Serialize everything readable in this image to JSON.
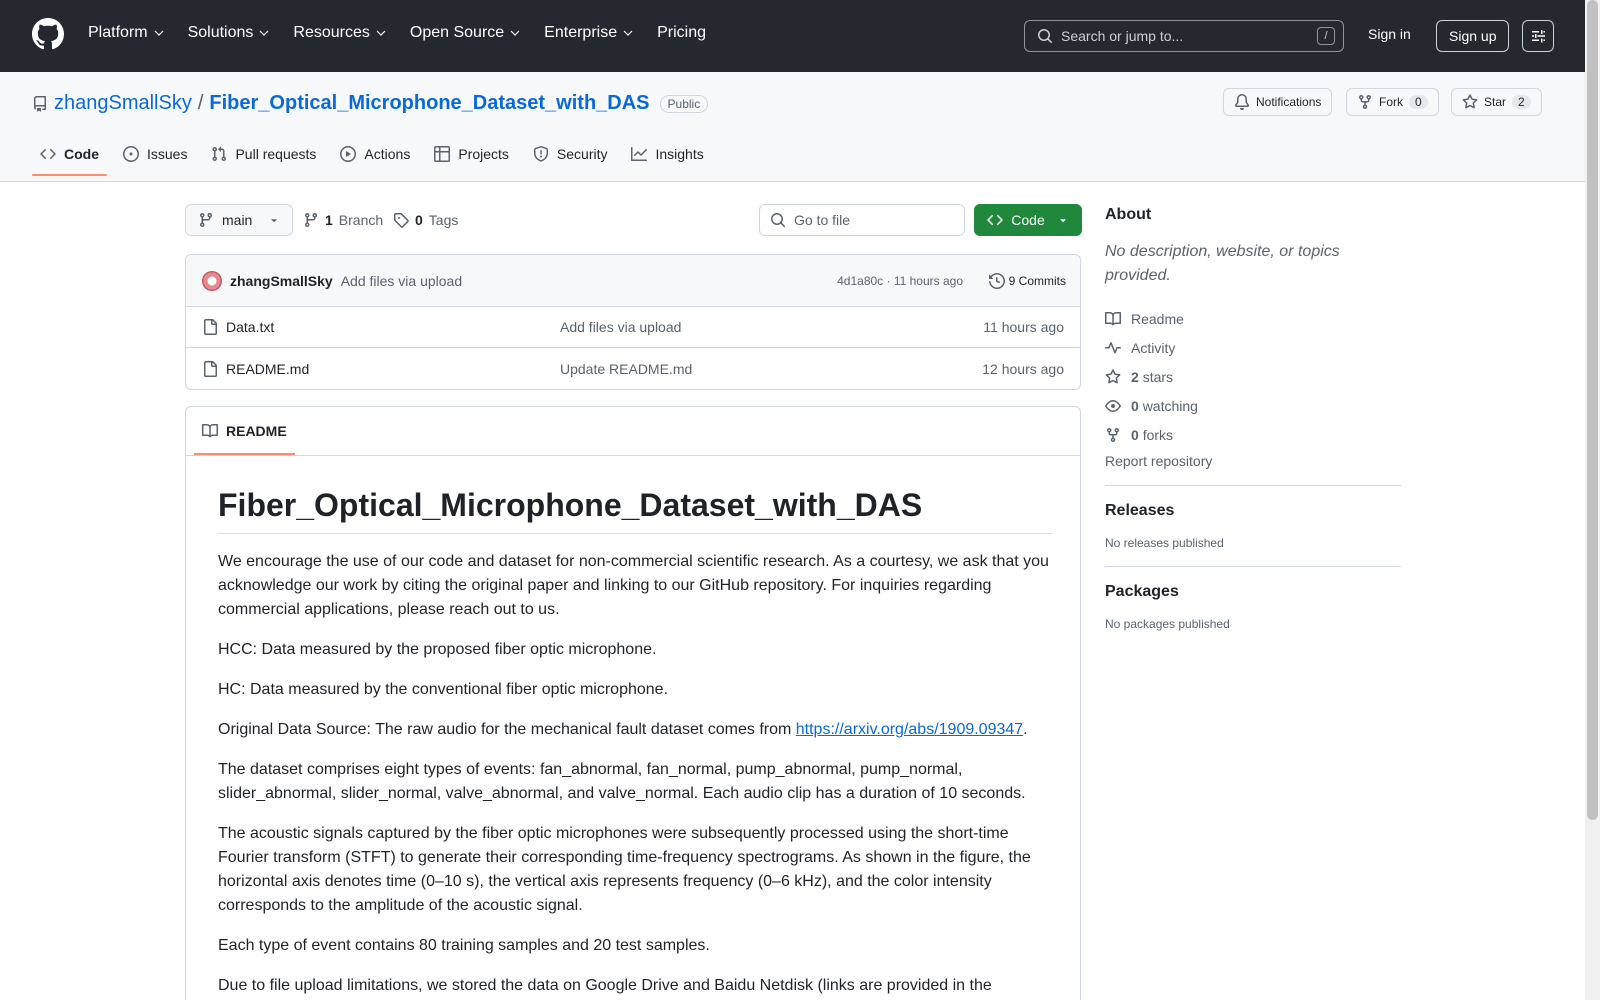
{
  "header": {
    "nav": [
      {
        "label": "Platform",
        "chevron": true
      },
      {
        "label": "Solutions",
        "chevron": true
      },
      {
        "label": "Resources",
        "chevron": true
      },
      {
        "label": "Open Source",
        "chevron": true
      },
      {
        "label": "Enterprise",
        "chevron": true
      },
      {
        "label": "Pricing",
        "chevron": false
      }
    ],
    "search_placeholder": "Search or jump to...",
    "search_shortcut": "/",
    "sign_in": "Sign in",
    "sign_up": "Sign up"
  },
  "repo": {
    "owner": "zhangSmallSky",
    "separator": "/",
    "name": "Fiber_Optical_Microphone_Dataset_with_DAS",
    "visibility": "Public",
    "notifications_label": "Notifications",
    "fork_label": "Fork",
    "fork_count": "0",
    "star_label": "Star",
    "star_count": "2"
  },
  "tabs": [
    "Code",
    "Issues",
    "Pull requests",
    "Actions",
    "Projects",
    "Security",
    "Insights"
  ],
  "toolbar": {
    "branch": "main",
    "branch_count": "1",
    "branch_label": "Branch",
    "tag_count": "0",
    "tag_label": "Tags",
    "go_to_file": "Go to file",
    "code_button": "Code"
  },
  "commit": {
    "author": "zhangSmallSky",
    "message": "Add files via upload",
    "sha_time": "4d1a80c · 11 hours ago",
    "commits": "9 Commits"
  },
  "files": [
    {
      "name": "Data.txt",
      "message": "Add files via upload",
      "time": "11 hours ago"
    },
    {
      "name": "README.md",
      "message": "Update README.md",
      "time": "12 hours ago"
    }
  ],
  "readme": {
    "tab": "README",
    "title": "Fiber_Optical_Microphone_Dataset_with_DAS",
    "p1": "We encourage the use of our code and dataset for non-commercial scientific research. As a courtesy, we ask that you acknowledge our work by citing the original paper and linking to our GitHub repository. For inquiries regarding commercial applications, please reach out to us.",
    "p2": "HCC: Data measured by the proposed fiber optic microphone.",
    "p3": "HC: Data measured by the conventional fiber optic microphone.",
    "p4_prefix": "Original Data Source: The raw audio for the mechanical fault dataset comes from ",
    "p4_link": "https://arxiv.org/abs/1909.09347",
    "p4_suffix": ".",
    "p5": "The dataset comprises eight types of events: fan_abnormal, fan_normal, pump_abnormal, pump_normal, slider_abnormal, slider_normal, valve_abnormal, and valve_normal. Each audio clip has a duration of 10 seconds.",
    "p6": "The acoustic signals captured by the fiber optic microphones were subsequently processed using the short-time Fourier transform (STFT) to generate their corresponding time-frequency spectrograms. As shown in the figure, the horizontal axis denotes time (0–10 s), the vertical axis represents frequency (0–6 kHz), and the color intensity corresponds to the amplitude of the acoustic signal.",
    "p7": "Each type of event contains 80 training samples and 20 test samples.",
    "p8": "Due to file upload limitations, we stored the data on Google Drive and Baidu Netdisk (links are provided in the"
  },
  "about": {
    "title": "About",
    "description": "No description, website, or topics provided.",
    "readme": "Readme",
    "activity": "Activity",
    "stars_count": "2",
    "stars_label": "stars",
    "watching_count": "0",
    "watching_label": "watching",
    "forks_count": "0",
    "forks_label": "forks",
    "report": "Report repository"
  },
  "releases": {
    "title": "Releases",
    "empty": "No releases published"
  },
  "packages": {
    "title": "Packages",
    "empty": "No packages published"
  }
}
